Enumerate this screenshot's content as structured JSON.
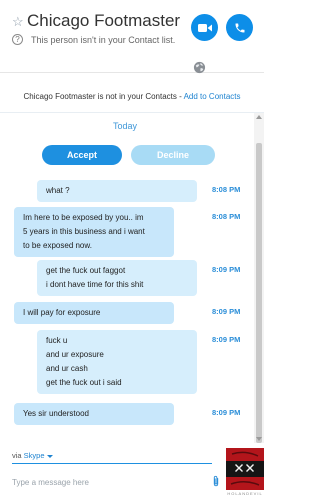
{
  "header": {
    "star_icon": "star-outline-icon",
    "title": "Chicago Footmaster",
    "subtitle": "This person isn't in your Contact list.",
    "help_icon": "question-circle-icon",
    "video_icon": "video-camera-icon",
    "call_icon": "phone-icon",
    "accent_color": "#0d8ee8"
  },
  "notice": {
    "text": "Chicago Footmaster is not in your Contacts - ",
    "link": "Add to Contacts"
  },
  "conversation": {
    "date_label": "Today",
    "accept_label": "Accept",
    "decline_label": "Decline",
    "messages": [
      {
        "sender": "me",
        "lines": [
          "what ?"
        ],
        "time": "8:08 PM"
      },
      {
        "sender": "them",
        "lines": [
          "Im here to be exposed by you.. im",
          "5 years in this business and i want",
          "to be exposed now."
        ],
        "time": "8:08 PM"
      },
      {
        "sender": "me",
        "lines": [
          "get the fuck out faggot",
          "i dont have time for this shit"
        ],
        "time": "8:09 PM"
      },
      {
        "sender": "them",
        "lines": [
          "I will pay for exposure"
        ],
        "time": "8:09 PM"
      },
      {
        "sender": "me",
        "lines": [
          "fuck u",
          "and ur exposure",
          "and ur cash",
          "get the fuck out i said"
        ],
        "time": "8:09 PM"
      },
      {
        "sender": "them",
        "lines": [
          "Yes sir understood"
        ],
        "time": "8:09 PM"
      }
    ]
  },
  "compose": {
    "via_label": "via ",
    "via_service": "Skype",
    "placeholder": "Type a message here",
    "attach_icon": "paperclip-icon"
  },
  "avatar": {
    "caption": "HOLANDEVIL"
  }
}
